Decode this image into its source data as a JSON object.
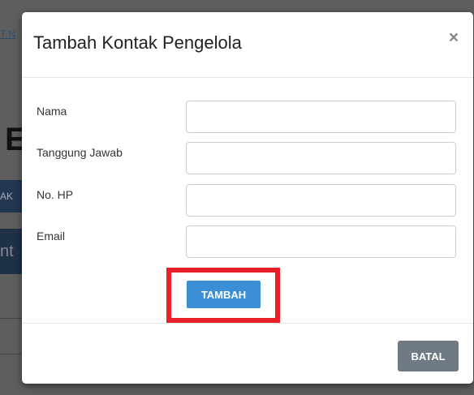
{
  "background": {
    "link_text": "T N",
    "heading_letter": "E",
    "button1_text": "AK",
    "button2_text": "nt"
  },
  "modal": {
    "title": "Tambah Kontak Pengelola",
    "close_symbol": "×",
    "fields": [
      {
        "label": "Nama",
        "value": "",
        "placeholder": ""
      },
      {
        "label": "Tanggung Jawab",
        "value": "",
        "placeholder": ""
      },
      {
        "label": "No. HP",
        "value": "",
        "placeholder": ""
      },
      {
        "label": "Email",
        "value": "",
        "placeholder": ""
      }
    ],
    "submit_label": "TAMBAH",
    "cancel_label": "BATAL"
  },
  "colors": {
    "primary_button": "#3a8fd6",
    "secondary_button": "#6f7a84",
    "highlight": "#e8202a",
    "overlay": "#5e5e5e"
  }
}
